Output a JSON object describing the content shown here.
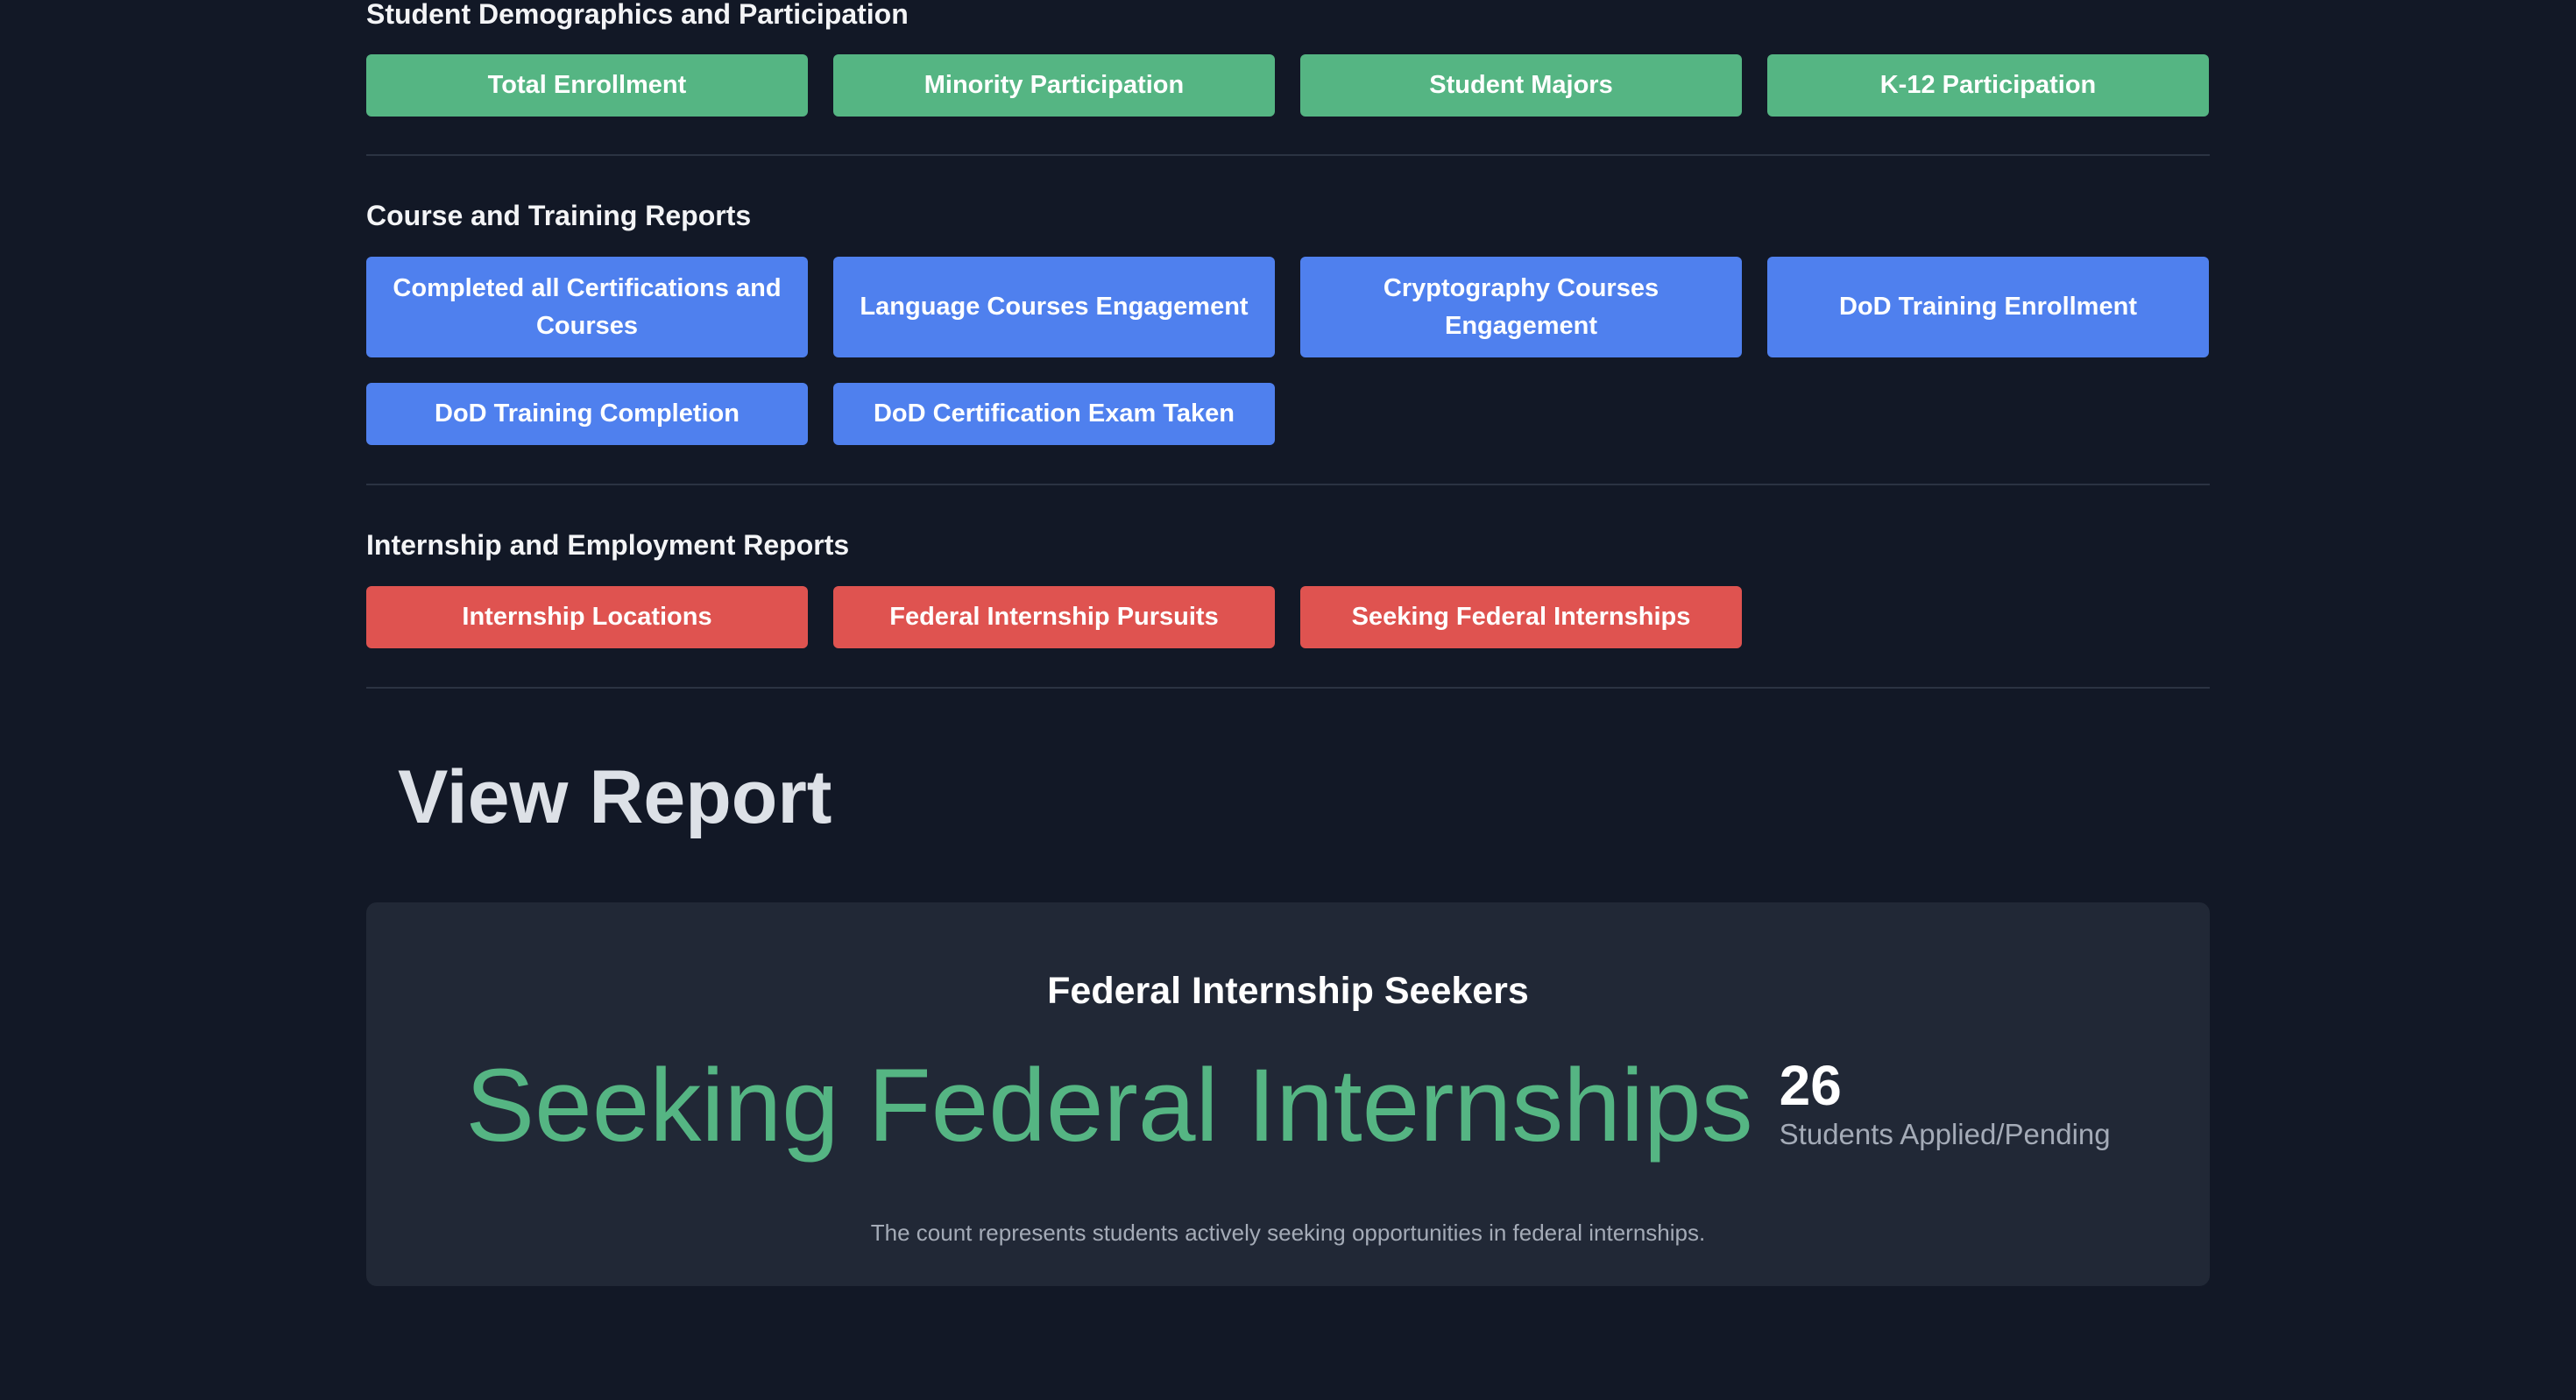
{
  "sections": {
    "demographics": {
      "title": "Student Demographics and Participation",
      "buttons": [
        "Total Enrollment",
        "Minority Participation",
        "Student Majors",
        "K-12 Participation"
      ],
      "color": "#55b583"
    },
    "courses": {
      "title": "Course and Training Reports",
      "buttons": [
        "Completed all Certifications and Courses",
        "Language Courses Engagement",
        "Cryptography Courses Engagement",
        "DoD Training Enrollment",
        "DoD Training Completion",
        "DoD Certification Exam Taken"
      ],
      "color": "#4f80ee"
    },
    "internships": {
      "title": "Internship and Employment Reports",
      "buttons": [
        "Internship Locations",
        "Federal Internship Pursuits",
        "Seeking Federal Internships"
      ],
      "color": "#df5350"
    }
  },
  "view_report": {
    "title": "View Report",
    "card": {
      "title": "Federal Internship Seekers",
      "metric_label": "Seeking Federal Internships",
      "metric_value": "26",
      "metric_caption": "Students Applied/Pending",
      "note": "The count represents students actively seeking opportunities in federal internships."
    }
  },
  "colors": {
    "background": "#121826",
    "card_background": "#212836",
    "accent_green": "#55b583",
    "accent_blue": "#4f80ee",
    "accent_red": "#df5350"
  }
}
